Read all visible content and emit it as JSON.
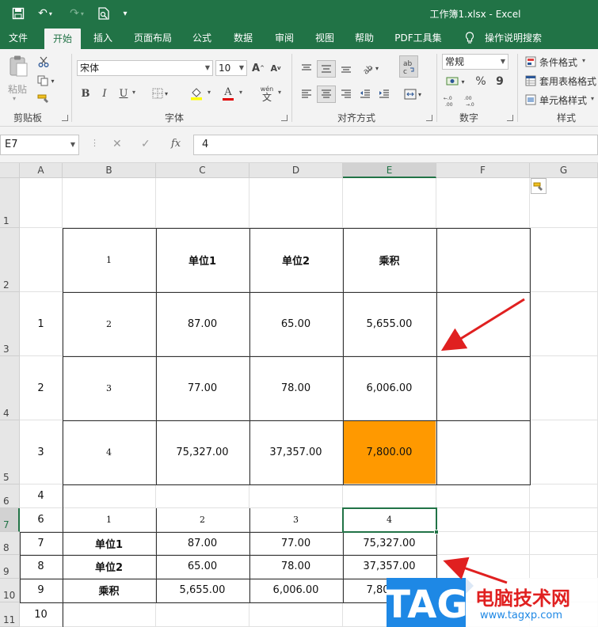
{
  "titlebar": {
    "title": "工作簿1.xlsx  -  Excel",
    "save_icon": "save-icon",
    "undo_icon": "undo-icon",
    "redo_icon": "redo-icon",
    "preview_icon": "print-preview-icon"
  },
  "tabs": [
    "文件",
    "开始",
    "插入",
    "页面布局",
    "公式",
    "数据",
    "审阅",
    "视图",
    "帮助",
    "PDF工具集",
    "操作说明搜索"
  ],
  "ribbon": {
    "clipboard": {
      "paste": "粘贴",
      "label": "剪贴板"
    },
    "font": {
      "name": "宋体",
      "size": "10",
      "label": "字体",
      "bold": "B",
      "italic": "I",
      "underline": "U",
      "grow": "A",
      "shrink": "A",
      "wen": "wén"
    },
    "align": {
      "label": "对齐方式"
    },
    "number": {
      "format": "常规",
      "label": "数字",
      "percent": "%",
      "comma": "9"
    },
    "styles": {
      "cond": "条件格式",
      "table": "套用表格格式",
      "cell": "单元格样式",
      "label": "样式"
    }
  },
  "formula_bar": {
    "name_box": "E7",
    "fx": "fx",
    "value": "4"
  },
  "columns": [
    "A",
    "B",
    "C",
    "D",
    "E",
    "F",
    "G"
  ],
  "rows": [
    "1",
    "2",
    "3",
    "4",
    "5",
    "6",
    "7",
    "8",
    "9",
    "10",
    "11"
  ],
  "cells": {
    "B2": "1",
    "C2": "单位1",
    "D2": "单位2",
    "E2": "乘积",
    "A3": "1",
    "B3": "2",
    "C3": "87.00",
    "D3": "65.00",
    "E3": "5,655.00",
    "A4": "2",
    "B4": "3",
    "C4": "77.00",
    "D4": "78.00",
    "E4": "6,006.00",
    "A5": "3",
    "B5": "4",
    "C5": "75,327.00",
    "D5": "37,357.00",
    "E5": "7,800.00",
    "A6": "4",
    "A7": "6",
    "B7": "1",
    "C7": "2",
    "D7": "3",
    "E7": "4",
    "A8": "7",
    "B8": "单位1",
    "C8": "87.00",
    "D8": "77.00",
    "E8": "75,327.00",
    "A9": "8",
    "B9": "单位2",
    "C9": "65.00",
    "D9": "78.00",
    "E9": "37,357.00",
    "A10": "9",
    "B10": "乘积",
    "C10": "5,655.00",
    "D10": "6,006.00",
    "E10": "7,800.00",
    "A11": "10"
  },
  "colors": {
    "excel_green": "#217346",
    "highlight": "#ff9900",
    "arrow": "#e02020"
  },
  "watermark": {
    "tag": "TAG",
    "site_cn": "电脑技术网",
    "url": "www.tagxp.com"
  }
}
